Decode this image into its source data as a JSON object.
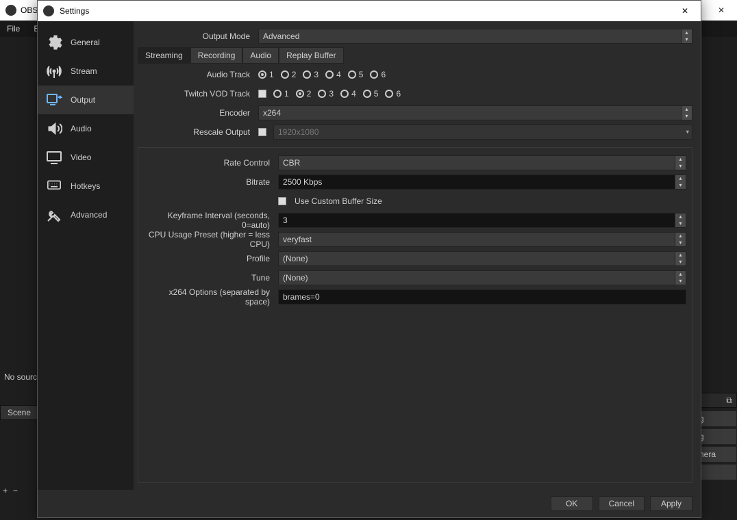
{
  "bg": {
    "title_prefix": "OBS",
    "menubar": [
      "File",
      "E"
    ],
    "no_source": "No sourc",
    "scene_tab": "Scene",
    "right_header_icon": "⧉",
    "right_buttons": [
      "g",
      "g",
      "nera",
      ""
    ]
  },
  "dialog": {
    "title": "Settings",
    "close": "✕"
  },
  "sidebar": {
    "items": [
      {
        "label": "General"
      },
      {
        "label": "Stream"
      },
      {
        "label": "Output"
      },
      {
        "label": "Audio"
      },
      {
        "label": "Video"
      },
      {
        "label": "Hotkeys"
      },
      {
        "label": "Advanced"
      }
    ]
  },
  "output": {
    "mode_label": "Output Mode",
    "mode_value": "Advanced",
    "tabs": [
      {
        "label": "Streaming"
      },
      {
        "label": "Recording"
      },
      {
        "label": "Audio"
      },
      {
        "label": "Replay Buffer"
      }
    ],
    "audio_track_label": "Audio Track",
    "vod_track_label": "Twitch VOD Track",
    "tracks": [
      "1",
      "2",
      "3",
      "4",
      "5",
      "6"
    ],
    "encoder_label": "Encoder",
    "encoder_value": "x264",
    "rescale_label": "Rescale Output",
    "rescale_placeholder": "1920x1080",
    "rate_control_label": "Rate Control",
    "rate_control_value": "CBR",
    "bitrate_label": "Bitrate",
    "bitrate_value": "2500 Kbps",
    "custom_buffer_label": "Use Custom Buffer Size",
    "keyframe_label": "Keyframe Interval (seconds, 0=auto)",
    "keyframe_value": "3",
    "cpu_preset_label": "CPU Usage Preset (higher = less CPU)",
    "cpu_preset_value": "veryfast",
    "profile_label": "Profile",
    "profile_value": "(None)",
    "tune_label": "Tune",
    "tune_value": "(None)",
    "x264_opts_label": "x264 Options (separated by space)",
    "x264_opts_value": "brames=0"
  },
  "footer": {
    "ok": "OK",
    "cancel": "Cancel",
    "apply": "Apply"
  }
}
